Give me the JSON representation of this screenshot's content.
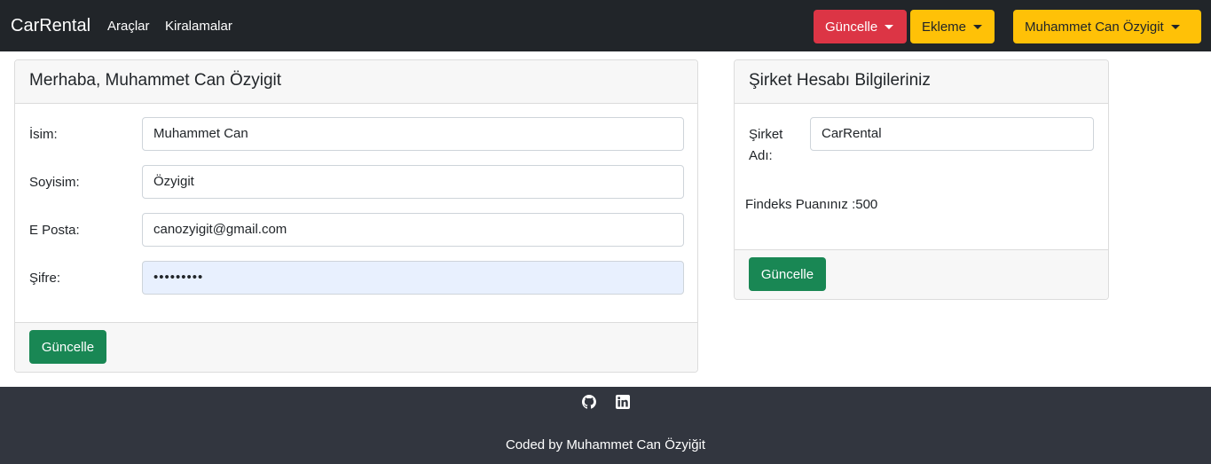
{
  "navbar": {
    "brand": "CarRental",
    "links": [
      "Araçlar",
      "Kiralamalar"
    ],
    "update_menu": "Güncelle",
    "add_menu": "Ekleme",
    "user_menu": "Muhammet Can Özyigit",
    "colors": {
      "background": "#212529",
      "danger": "#dc3545",
      "warning": "#ffc107"
    }
  },
  "profile_card": {
    "title": "Merhaba, Muhammet Can Özyigit",
    "fields": [
      {
        "label": "İsim:",
        "value": "Muhammet Can"
      },
      {
        "label": "Soyisim:",
        "value": "Özyigit"
      },
      {
        "label": "E Posta:",
        "value": "canozyigit@gmail.com"
      },
      {
        "label": "Şifre:",
        "value": "•••••••••"
      }
    ],
    "button": "Güncelle"
  },
  "company_card": {
    "title": "Şirket Hesabı Bilgileriniz",
    "company_label_line1": "Şirket",
    "company_label_line2": "Adı:",
    "company_value": "CarRental",
    "findeks": "Findeks Puanınız :500",
    "button": "Güncelle"
  },
  "footer": {
    "icons": [
      "github-icon",
      "linkedin-icon"
    ],
    "credit": "Coded by Muhammet Can Özyiğit",
    "background": "#32363f"
  }
}
